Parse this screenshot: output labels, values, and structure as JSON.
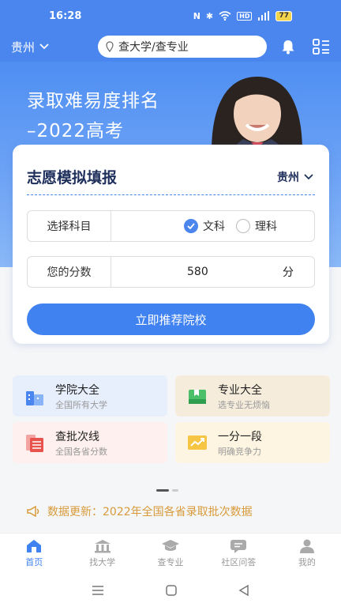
{
  "status_bar": {
    "time": "16:28",
    "battery": "77"
  },
  "header": {
    "city": "贵州",
    "search_placeholder": "查大学/查专业"
  },
  "banner": {
    "title_line1": "录取难易度排名",
    "title_line2": "–2022高考"
  },
  "form_card": {
    "title": "志愿模拟填报",
    "city": "贵州",
    "subject_label": "选择科目",
    "options": [
      {
        "label": "文科",
        "checked": true
      },
      {
        "label": "理科",
        "checked": false
      }
    ],
    "score_label": "您的分数",
    "score_value": "580",
    "score_unit": "分",
    "submit_label": "立即推荐院校"
  },
  "features": [
    {
      "title": "学院大全",
      "subtitle": "全国所有大学",
      "icon": "building-icon"
    },
    {
      "title": "专业大全",
      "subtitle": "选专业无烦恼",
      "icon": "book-icon"
    },
    {
      "title": "查批次线",
      "subtitle": "全国各省分数",
      "icon": "list-icon"
    },
    {
      "title": "一分一段",
      "subtitle": "明确竞争力",
      "icon": "trend-icon"
    }
  ],
  "notice": {
    "text": "数据更新：2022年全国各省录取批次数据"
  },
  "tabs": [
    {
      "label": "首页",
      "icon": "home-icon",
      "active": true
    },
    {
      "label": "找大学",
      "icon": "university-icon",
      "active": false
    },
    {
      "label": "查专业",
      "icon": "graduation-cap-icon",
      "active": false
    },
    {
      "label": "社区问答",
      "icon": "chat-icon",
      "active": false
    },
    {
      "label": "我的",
      "icon": "user-icon",
      "active": false
    }
  ],
  "colors": {
    "primary": "#3f82f0",
    "notice": "#d89a3a"
  }
}
